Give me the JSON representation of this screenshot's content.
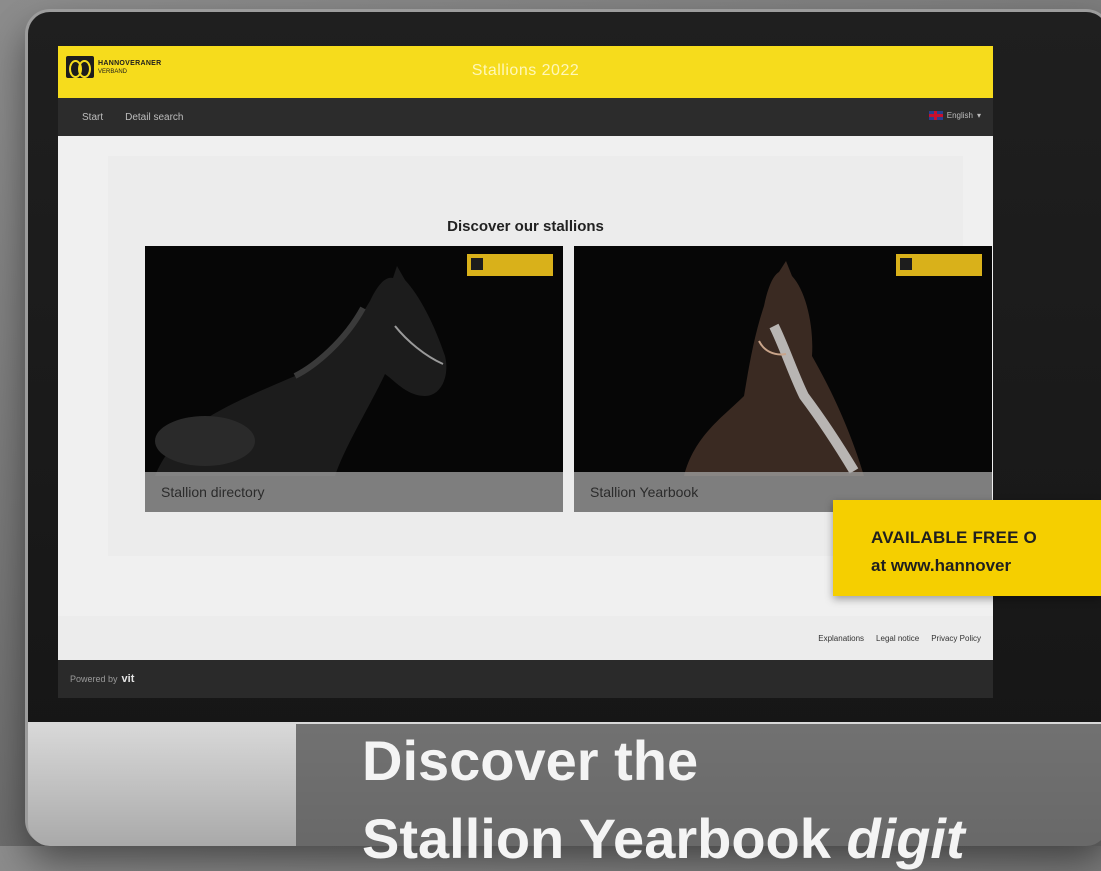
{
  "header": {
    "logo_name": "HANNOVERANER",
    "logo_sub": "VERBAND",
    "title": "Stallions 2022"
  },
  "nav": {
    "items": [
      "Start",
      "Detail search"
    ],
    "language": "English"
  },
  "main": {
    "title": "Discover our stallions",
    "cards": [
      {
        "label": "Stallion directory"
      },
      {
        "label": "Stallion Yearbook"
      }
    ]
  },
  "footer": {
    "links": [
      "Explanations",
      "Legal notice",
      "Privacy Policy"
    ],
    "powered_by": "Powered by",
    "powered_brand": "vit"
  },
  "banner": {
    "line1": "AVAILABLE FREE O",
    "line2": "at www.hannover"
  },
  "headline": {
    "line1": "Discover the",
    "line2_a": "Stallion Yearbook ",
    "line2_b": "digit"
  },
  "colors": {
    "brand_yellow": "#f6dc1c",
    "banner_yellow": "#f5cf00",
    "nav_dark": "#2c2c2c"
  }
}
